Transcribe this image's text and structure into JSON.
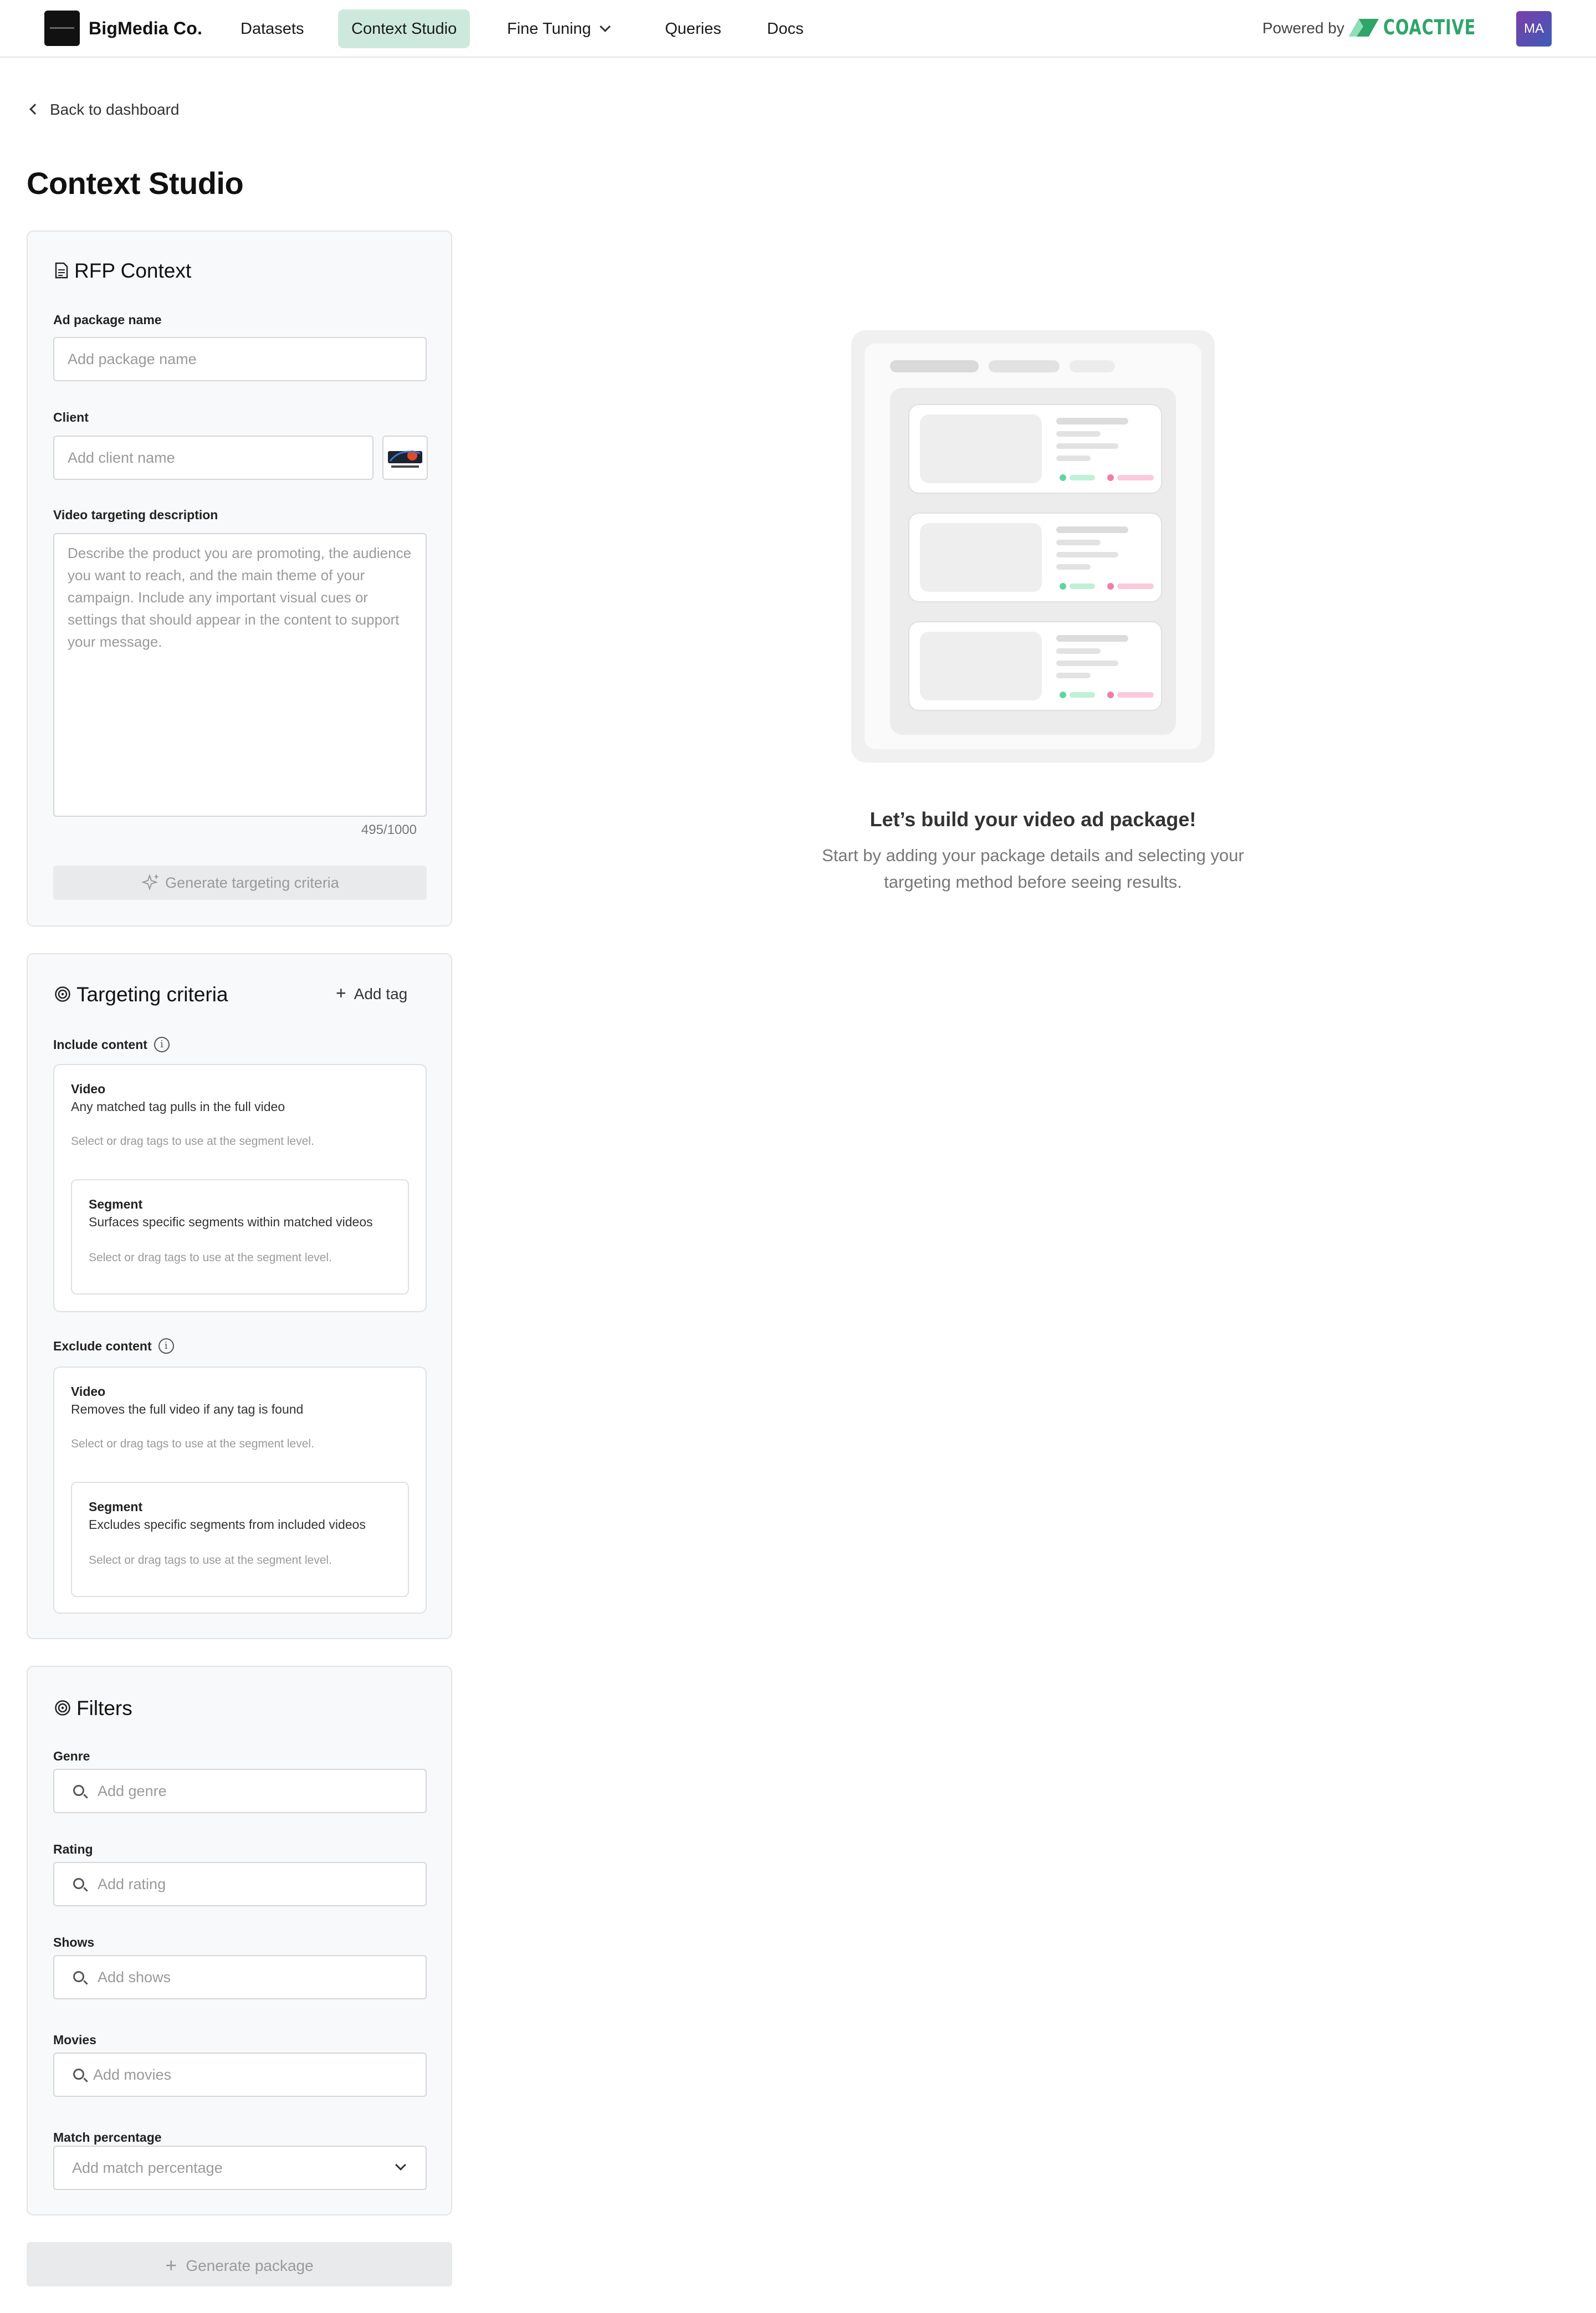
{
  "nav": {
    "brand": "BigMedia Co.",
    "items": [
      {
        "label": "Datasets"
      },
      {
        "label": "Context Studio"
      },
      {
        "label": "Fine Tuning"
      },
      {
        "label": "Queries"
      },
      {
        "label": "Docs"
      }
    ],
    "powered_by": "Powered by",
    "partner": "COACTIVE",
    "avatar_initials": "MA"
  },
  "back_link": "Back to dashboard",
  "page_title": "Context Studio",
  "rfp": {
    "title": "RFP Context",
    "package_name_label": "Ad package name",
    "package_name_placeholder": "Add package name",
    "client_label": "Client",
    "client_placeholder": "Add client name",
    "description_label": "Video targeting description",
    "description_placeholder": "Describe the product you are promoting, the audience you want to reach, and the main theme of your campaign. Include any important visual cues or settings that should appear in the content to support your message.",
    "counter": "495/1000",
    "generate_button": "Generate targeting criteria"
  },
  "targeting": {
    "title": "Targeting criteria",
    "add_tag": "Add tag",
    "include_label": "Include content",
    "exclude_label": "Exclude content",
    "include_video": {
      "title": "Video",
      "desc": "Any matched tag pulls in the full video",
      "hint": "Select or drag tags to use at the segment level."
    },
    "include_segment": {
      "title": "Segment",
      "desc": "Surfaces specific segments within matched videos",
      "hint": "Select or drag tags to use at the segment level."
    },
    "exclude_video": {
      "title": "Video",
      "desc": "Removes the full video if any tag is found",
      "hint": "Select or drag tags to use at the segment level."
    },
    "exclude_segment": {
      "title": "Segment",
      "desc": "Excludes specific segments from included videos",
      "hint": "Select or drag tags to use at the segment level."
    }
  },
  "filters": {
    "title": "Filters",
    "genre_label": "Genre",
    "genre_placeholder": "Add genre",
    "rating_label": "Rating",
    "rating_placeholder": "Add rating",
    "shows_label": "Shows",
    "shows_placeholder": "Add shows",
    "movies_label": "Movies",
    "movies_placeholder": "Add movies",
    "match_label": "Match percentage",
    "match_placeholder": "Add match percentage"
  },
  "generate_package": "Generate package",
  "empty_state": {
    "title": "Let’s build your video ad package!",
    "subtitle": "Start by adding your package details and selecting your targeting method before seeing results."
  },
  "colors": {
    "active_nav": "#cde9dd",
    "brand_green": "#2fa56a",
    "tag_green": "#5fd6a2",
    "tag_pink": "#f47aa8"
  }
}
